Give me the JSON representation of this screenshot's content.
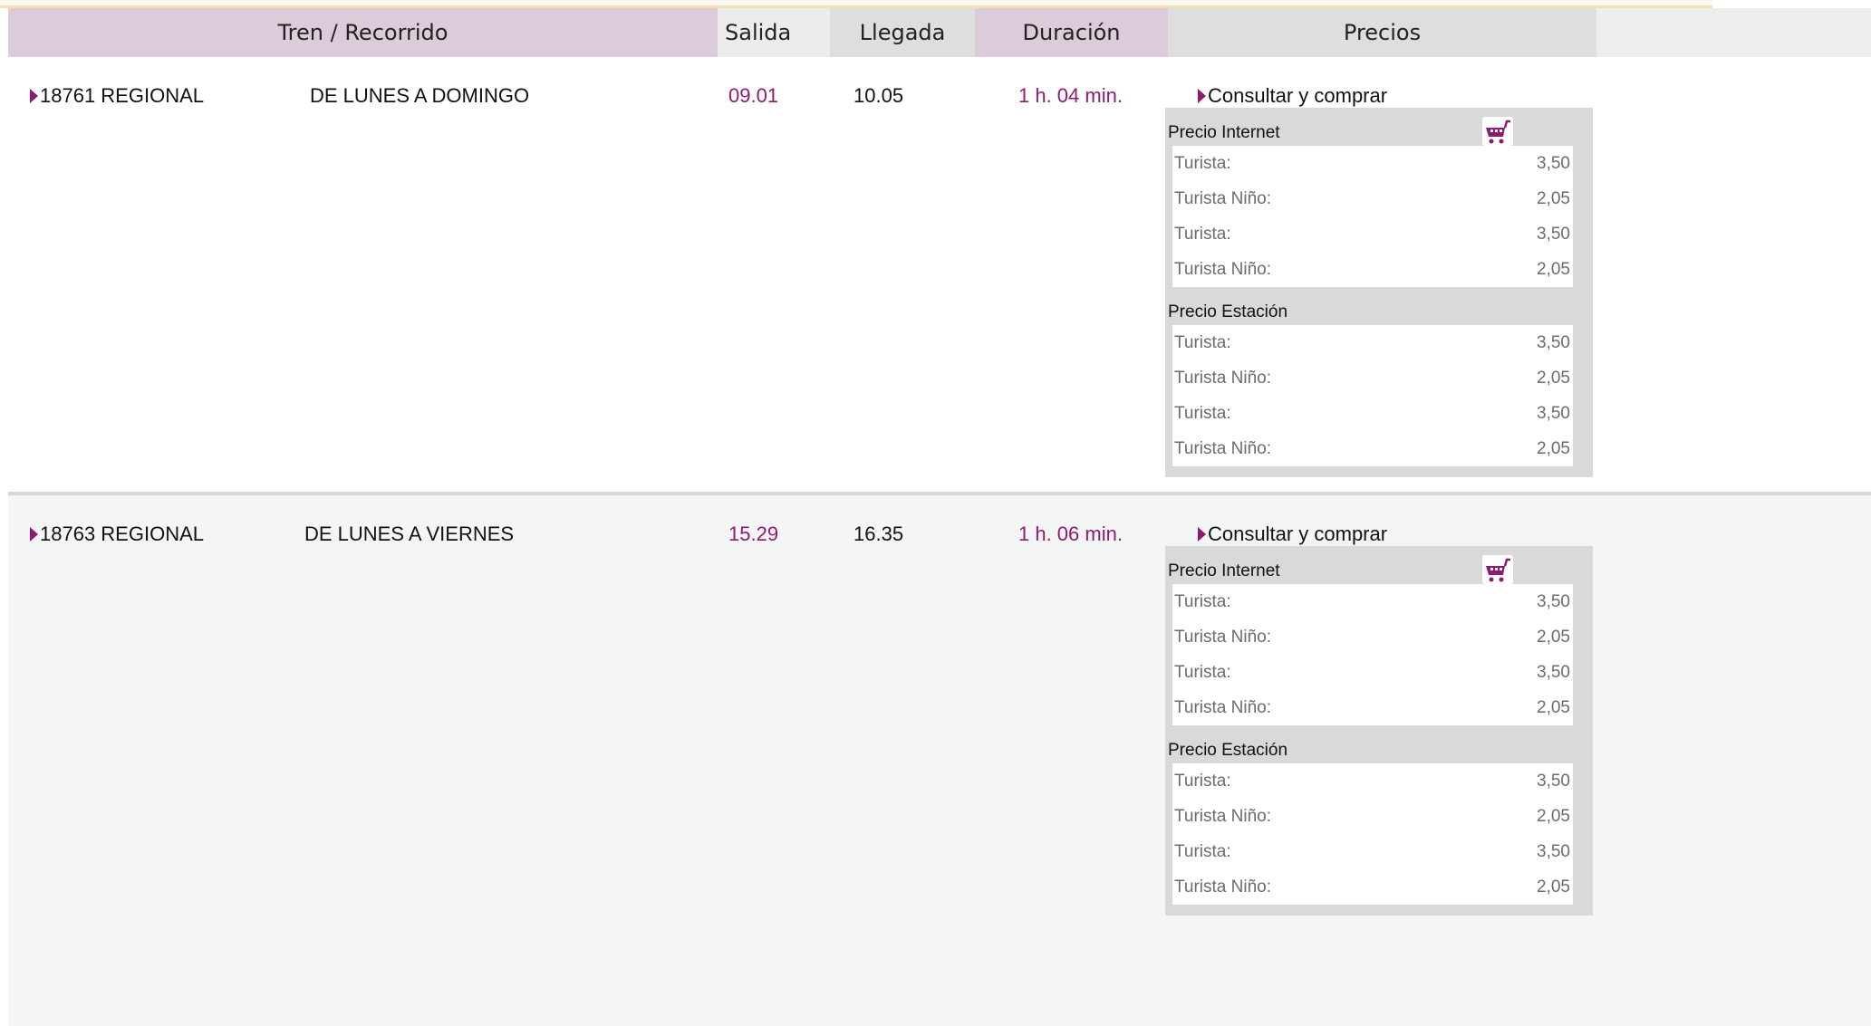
{
  "header": {
    "tren": "Tren / Recorrido",
    "salida": "Salida",
    "llegada": "Llegada",
    "duracion": "Duración",
    "precios": "Precios"
  },
  "trains": [
    {
      "train": "18761 REGIONAL",
      "days": "DE LUNES A DOMINGO",
      "salida": "09.01",
      "llegada": "10.05",
      "duracion": "1 h. 04 min.",
      "buy_label": "Consultar y comprar",
      "internet_title": "Precio Internet",
      "internet": [
        {
          "label": "Turista:",
          "price": "3,50"
        },
        {
          "label": "Turista Niño:",
          "price": "2,05"
        },
        {
          "label": "Turista:",
          "price": "3,50"
        },
        {
          "label": "Turista Niño:",
          "price": "2,05"
        }
      ],
      "station_title": "Precio Estación",
      "station": [
        {
          "label": "Turista:",
          "price": "3,50"
        },
        {
          "label": "Turista Niño:",
          "price": "2,05"
        },
        {
          "label": "Turista:",
          "price": "3,50"
        },
        {
          "label": "Turista Niño:",
          "price": "2,05"
        }
      ]
    },
    {
      "train": "18763 REGIONAL",
      "days": "DE LUNES A VIERNES",
      "salida": "15.29",
      "llegada": "16.35",
      "duracion": "1 h. 06 min.",
      "buy_label": "Consultar y comprar",
      "internet_title": "Precio Internet",
      "internet": [
        {
          "label": "Turista:",
          "price": "3,50"
        },
        {
          "label": "Turista Niño:",
          "price": "2,05"
        },
        {
          "label": "Turista:",
          "price": "3,50"
        },
        {
          "label": "Turista Niño:",
          "price": "2,05"
        }
      ],
      "station_title": "Precio Estación",
      "station": [
        {
          "label": "Turista:",
          "price": "3,50"
        },
        {
          "label": "Turista Niño:",
          "price": "2,05"
        },
        {
          "label": "Turista:",
          "price": "3,50"
        },
        {
          "label": "Turista Niño:",
          "price": "2,05"
        }
      ]
    }
  ],
  "icons": {
    "cart": "shopping-cart-icon",
    "arrow": "triangle-right-icon"
  },
  "colors": {
    "accent": "#8e1a73",
    "header_mauve": "#dccbd9"
  }
}
